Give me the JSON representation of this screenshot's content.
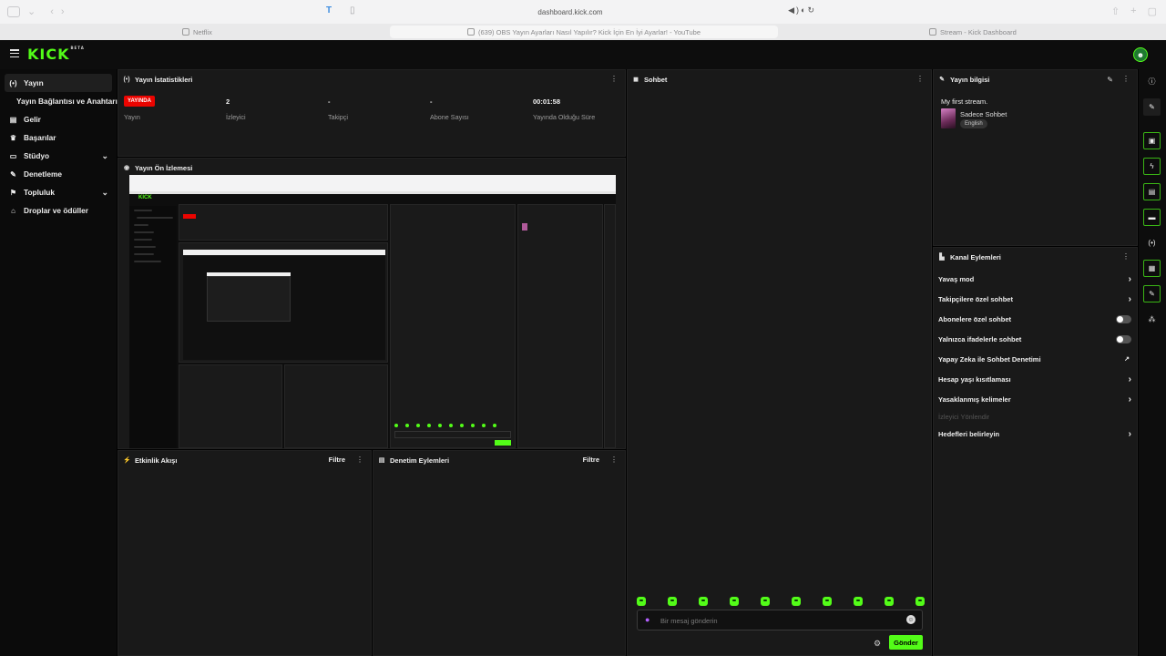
{
  "browser": {
    "url": "dashboard.kick.com",
    "tabs": [
      {
        "label": "Netflix"
      },
      {
        "label": "(639) OBS Yayın Ayarları Nasıl Yapılır? Kick İçin En İyi Ayarlar! - YouTube"
      },
      {
        "label": "Stream - Kick Dashboard"
      }
    ]
  },
  "app": {
    "logo": "KICK",
    "logo_badge": "BETA",
    "avatar_glyph": "☻"
  },
  "sidebar": {
    "items": [
      {
        "label": "Yayın",
        "icon": "broadcast-icon",
        "glyph": "(•)"
      },
      {
        "label": "Gelir",
        "icon": "wallet-icon",
        "glyph": "▤"
      },
      {
        "label": "Başarılar",
        "icon": "trophy-icon",
        "glyph": "♛"
      },
      {
        "label": "Stüdyo",
        "icon": "studio-icon",
        "glyph": "▭"
      },
      {
        "label": "Denetleme",
        "icon": "wrench-icon",
        "glyph": "✎"
      },
      {
        "label": "Topluluk",
        "icon": "community-icon",
        "glyph": "⚑"
      },
      {
        "label": "Droplar ve ödüller",
        "icon": "gift-icon",
        "glyph": "⌂"
      }
    ],
    "sub_item": "Yayın Bağlantısı ve Anahtarı"
  },
  "stats_panel": {
    "title": "Yayın İstatistikleri",
    "live_badge": "YAYINDA",
    "stats": [
      {
        "value": "",
        "label": "Yayın"
      },
      {
        "value": "2",
        "label": "İzleyici"
      },
      {
        "value": "-",
        "label": "Takipçi"
      },
      {
        "value": "-",
        "label": "Abone Sayısı"
      },
      {
        "value": "00:01:58",
        "label": "Yayında Olduğu Süre"
      }
    ]
  },
  "preview_panel": {
    "title": "Yayın Ön İzlemesi"
  },
  "activity_panel": {
    "title": "Etkinlik Akışı",
    "filter": "Filtre"
  },
  "moderation_panel": {
    "title": "Denetim Eylemleri",
    "filter": "Filtre"
  },
  "chat_panel": {
    "title": "Sohbet",
    "placeholder": "Bir mesaj gönderin",
    "send_label": "Gönder",
    "emote_count": 10
  },
  "stream_info": {
    "title": "Yayın bilgisi",
    "stream_title": "My first stream.",
    "category": "Sadece Sohbet",
    "language": "English"
  },
  "channel_actions": {
    "title": "Kanal Eylemleri",
    "rows": [
      {
        "label": "Yavaş mod",
        "control": "chevron"
      },
      {
        "label": "Takipçilere özel sohbet",
        "control": "chevron"
      },
      {
        "label": "Abonelere özel sohbet",
        "control": "toggle"
      },
      {
        "label": "Yalnızca ifadelerle sohbet",
        "control": "toggle"
      },
      {
        "label": "Yapay Zeka ile Sohbet Denetimi",
        "control": "external"
      },
      {
        "label": "Hesap yaşı kısıtlaması",
        "control": "chevron"
      },
      {
        "label": "Yasaklanmış kelimeler",
        "control": "chevron"
      },
      {
        "label": "İzleyici Yönlendir",
        "control": "none"
      },
      {
        "label": "Hedefleri belirleyin",
        "control": "chevron"
      }
    ]
  },
  "colors": {
    "accent": "#53fc18",
    "live": "#eb0400",
    "panel": "#191919"
  }
}
